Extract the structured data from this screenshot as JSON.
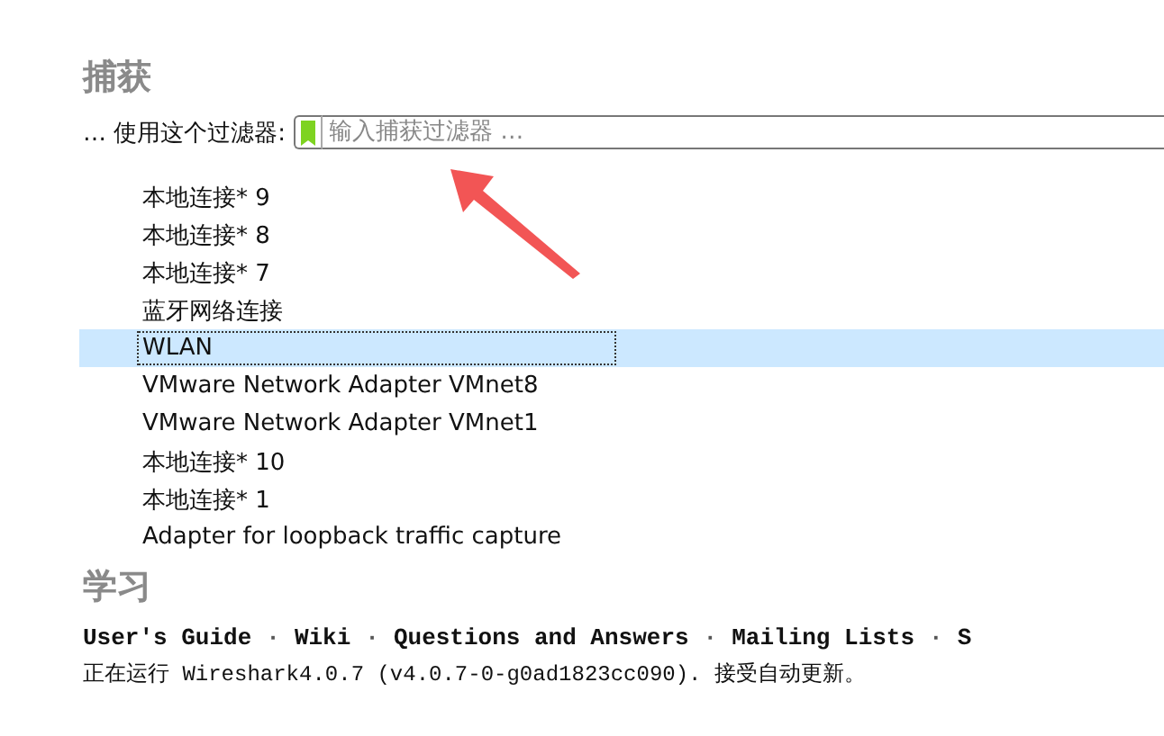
{
  "capture": {
    "heading": "捕获",
    "filter_label": "… 使用这个过滤器:",
    "filter": {
      "placeholder": "输入捕获过滤器 …"
    }
  },
  "interfaces": [
    {
      "name": "本地连接* 9",
      "selected": false
    },
    {
      "name": "本地连接* 8",
      "selected": false
    },
    {
      "name": "本地连接* 7",
      "selected": false
    },
    {
      "name": "蓝牙网络连接",
      "selected": false
    },
    {
      "name": "WLAN",
      "selected": true
    },
    {
      "name": "VMware Network Adapter VMnet8",
      "selected": false
    },
    {
      "name": "VMware Network Adapter VMnet1",
      "selected": false
    },
    {
      "name": "本地连接* 10",
      "selected": false
    },
    {
      "name": "本地连接* 1",
      "selected": false
    },
    {
      "name": "Adapter for loopback traffic capture",
      "selected": false
    }
  ],
  "learn": {
    "heading": "学习",
    "links": [
      "User's Guide",
      "Wiki",
      "Questions and Answers",
      "Mailing Lists",
      "S"
    ],
    "separator": "·"
  },
  "status": "正在运行 Wireshark4.0.7 (v4.0.7-0-g0ad1823cc090). 接受自动更新。"
}
